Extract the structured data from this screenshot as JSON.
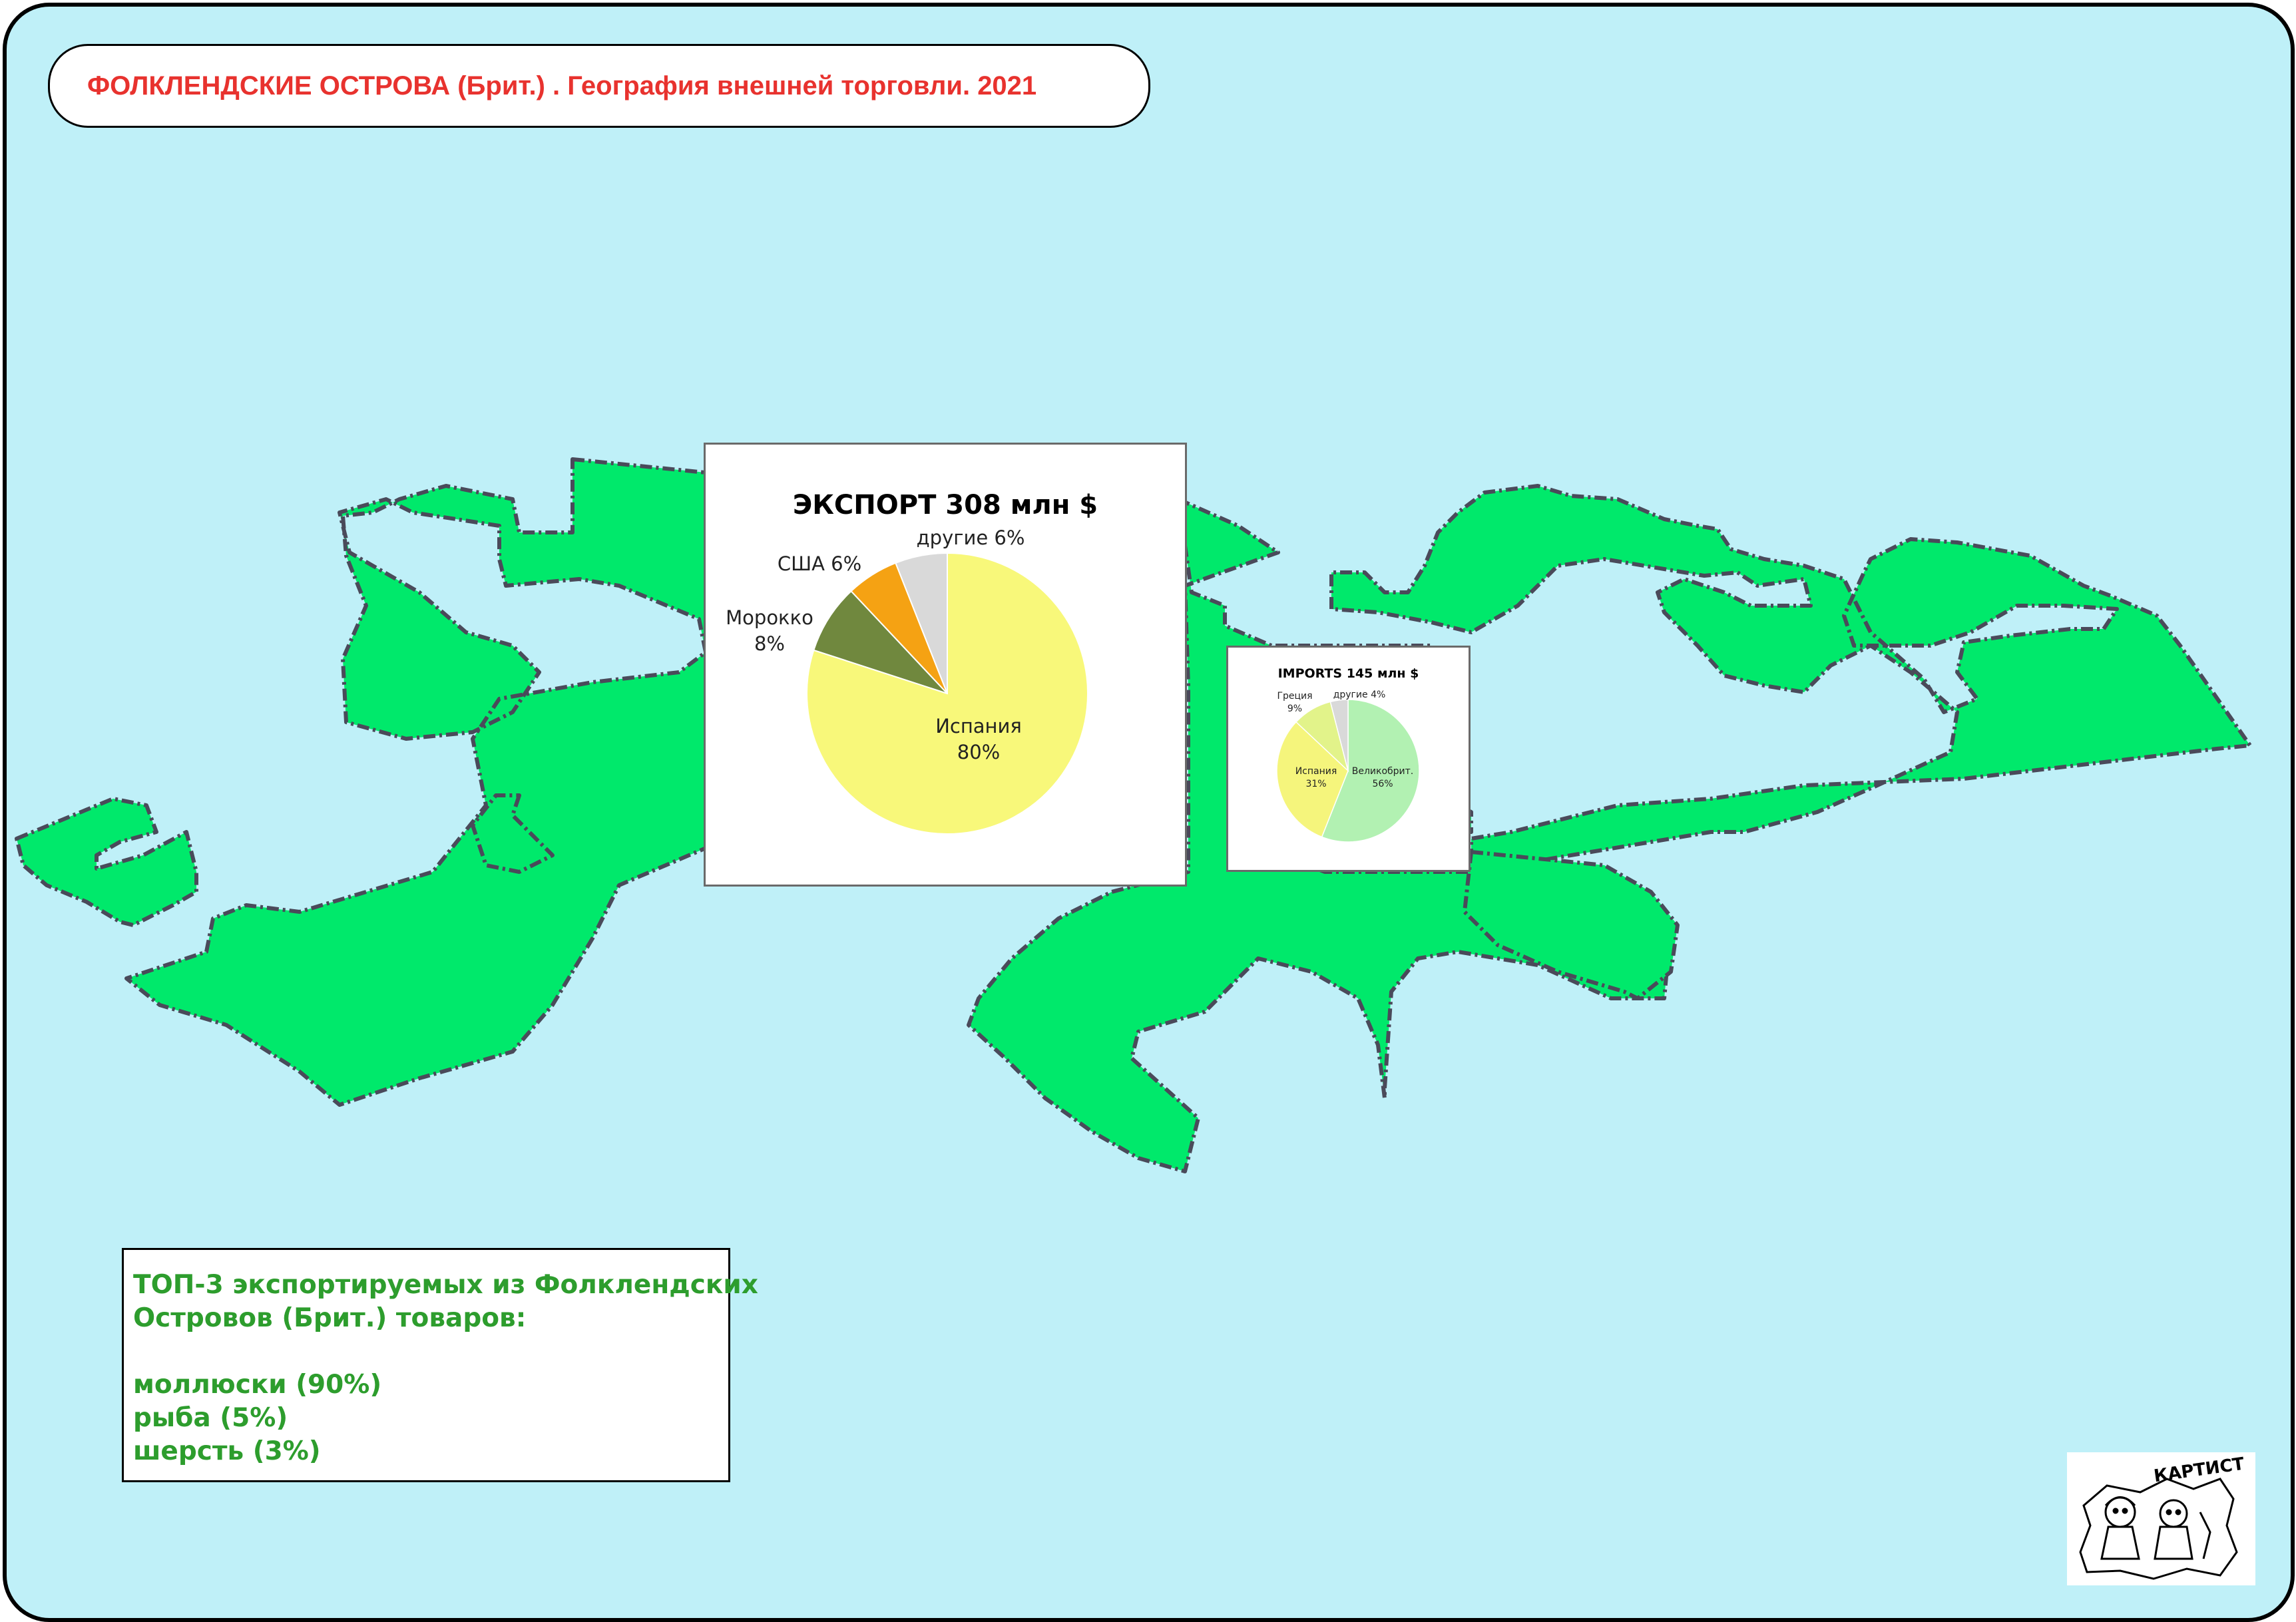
{
  "title": "ФОЛКЛЕНДСКИЕ ОСТРОВА (Брит.) . География внешней торговли. 2021",
  "colors": {
    "ocean": "#bff0f8",
    "land": "#00e96b",
    "coast": "#4a4a5a",
    "title_text": "#e8322e",
    "top3_text": "#2d9d2d"
  },
  "export_chart": {
    "title": "ЭКСПОРТ 308 млн $",
    "type": "pie",
    "slices": [
      {
        "label": "Испания",
        "value_label": "80%",
        "value": 80,
        "color": "#f8f87a"
      },
      {
        "label": "Морокко",
        "value_label": "8%",
        "value": 8,
        "color": "#70883e"
      },
      {
        "label": "США",
        "value_label": "6%",
        "value": 6,
        "color": "#f5a213"
      },
      {
        "label": "другие",
        "value_label": "6%",
        "value": 6,
        "color": "#d9d9d9"
      }
    ]
  },
  "import_chart": {
    "title": "IMPORTS 145 млн $",
    "type": "pie",
    "slices": [
      {
        "label": "Великобрит.",
        "value_label": "56%",
        "value": 56,
        "color": "#b2f1b2"
      },
      {
        "label": "Испания",
        "value_label": "31%",
        "value": 31,
        "color": "#f5f57c"
      },
      {
        "label": "Греция",
        "value_label": "9%",
        "value": 9,
        "color": "#e2f38a"
      },
      {
        "label": "другие",
        "value_label": "4%",
        "value": 4,
        "color": "#d9d9d9"
      }
    ]
  },
  "top3": {
    "heading_line1": "ТОП-3 экспортируемых из Фолклендских",
    "heading_line2": "Островов (Брит.) товаров:",
    "items": [
      "моллюски (90%)",
      "рыба (5%)",
      "шерсть (3%)"
    ]
  },
  "logo": {
    "text": "КАРТИСТ",
    "icon": "cartographer-mascot-icon"
  }
}
